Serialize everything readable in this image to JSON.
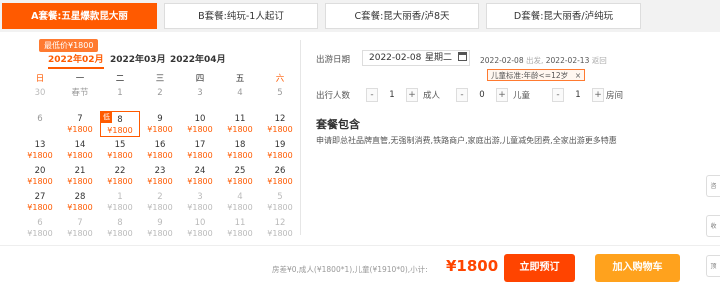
{
  "tabs": [
    {
      "label": "A套餐:五星爆款昆大丽"
    },
    {
      "label": "B套餐:纯玩-1人起订"
    },
    {
      "label": "C套餐:昆大丽香/泸8天"
    },
    {
      "label": "D套餐:昆大丽香/泸纯玩"
    }
  ],
  "calendar": {
    "min_price_tag": "最低价¥1800",
    "months": [
      "2022年02月",
      "2022年03月",
      "2022年04月"
    ],
    "weekdays": [
      "日",
      "一",
      "二",
      "三",
      "四",
      "五",
      "六"
    ],
    "selected_marker": "低",
    "weeks": [
      [
        {
          "d": "30",
          "p": "",
          "s": "other"
        },
        {
          "d": "春节",
          "p": "",
          "s": "past"
        },
        {
          "d": "1",
          "p": "",
          "s": "past"
        },
        {
          "d": "2",
          "p": "",
          "s": "past"
        },
        {
          "d": "3",
          "p": "",
          "s": "past"
        },
        {
          "d": "4",
          "p": "",
          "s": "past"
        },
        {
          "d": "5",
          "p": "",
          "s": "past"
        }
      ],
      [
        {
          "d": "6",
          "p": "",
          "s": "past"
        },
        {
          "d": "7",
          "p": "¥1800",
          "s": ""
        },
        {
          "d": "8",
          "p": "¥1800",
          "s": "selected"
        },
        {
          "d": "9",
          "p": "¥1800",
          "s": ""
        },
        {
          "d": "10",
          "p": "¥1800",
          "s": ""
        },
        {
          "d": "11",
          "p": "¥1800",
          "s": ""
        },
        {
          "d": "12",
          "p": "¥1800",
          "s": ""
        }
      ],
      [
        {
          "d": "13",
          "p": "¥1800",
          "s": ""
        },
        {
          "d": "14",
          "p": "¥1800",
          "s": ""
        },
        {
          "d": "15",
          "p": "¥1800",
          "s": ""
        },
        {
          "d": "16",
          "p": "¥1800",
          "s": ""
        },
        {
          "d": "17",
          "p": "¥1800",
          "s": ""
        },
        {
          "d": "18",
          "p": "¥1800",
          "s": ""
        },
        {
          "d": "19",
          "p": "¥1800",
          "s": ""
        }
      ],
      [
        {
          "d": "20",
          "p": "¥1800",
          "s": ""
        },
        {
          "d": "21",
          "p": "¥1800",
          "s": ""
        },
        {
          "d": "22",
          "p": "¥1800",
          "s": ""
        },
        {
          "d": "23",
          "p": "¥1800",
          "s": ""
        },
        {
          "d": "24",
          "p": "¥1800",
          "s": ""
        },
        {
          "d": "25",
          "p": "¥1800",
          "s": ""
        },
        {
          "d": "26",
          "p": "¥1800",
          "s": ""
        }
      ],
      [
        {
          "d": "27",
          "p": "¥1800",
          "s": ""
        },
        {
          "d": "28",
          "p": "¥1800",
          "s": ""
        },
        {
          "d": "1",
          "p": "¥1800",
          "s": "other"
        },
        {
          "d": "2",
          "p": "¥1800",
          "s": "other"
        },
        {
          "d": "3",
          "p": "¥1800",
          "s": "other"
        },
        {
          "d": "4",
          "p": "¥1800",
          "s": "other"
        },
        {
          "d": "5",
          "p": "¥1800",
          "s": "other"
        }
      ],
      [
        {
          "d": "6",
          "p": "¥1800",
          "s": "other"
        },
        {
          "d": "7",
          "p": "¥1800",
          "s": "other"
        },
        {
          "d": "8",
          "p": "¥1800",
          "s": "other"
        },
        {
          "d": "9",
          "p": "¥1800",
          "s": "other"
        },
        {
          "d": "10",
          "p": "¥1800",
          "s": "other"
        },
        {
          "d": "11",
          "p": "¥1800",
          "s": "other"
        },
        {
          "d": "12",
          "p": "¥1800",
          "s": "other"
        }
      ]
    ]
  },
  "form": {
    "departure_label": "出游日期",
    "date_value": "2022-02-08",
    "date_weekday": "星期二",
    "departure_note_date": "2022-02-08",
    "departure_note_suffix": "出发,",
    "return_note_date": "2022-02-13",
    "return_note_suffix": "返回",
    "child_tip": "儿童标准:年龄<=12岁",
    "tip_close": "×",
    "people_label": "出行人数",
    "rooms_value": "1",
    "adult_label": "成人",
    "adult_value": "0",
    "child_label": "儿童",
    "child_value": "1",
    "room_label": "房间",
    "minus": "-",
    "plus": "+"
  },
  "package": {
    "title": "套餐包含",
    "desc": "申请即总社品牌直管,无强制消费,铁路商户,家庭出游,儿童减免团费,全家出游更多特惠"
  },
  "bottom": {
    "summary": "房差¥0,成人(¥1800*1),儿童(¥1910*0),小计:",
    "total": "¥1800",
    "book_label": "立即预订",
    "cart_label": "加入购物车"
  },
  "side_tools": [
    "咨",
    "收",
    "顶"
  ]
}
